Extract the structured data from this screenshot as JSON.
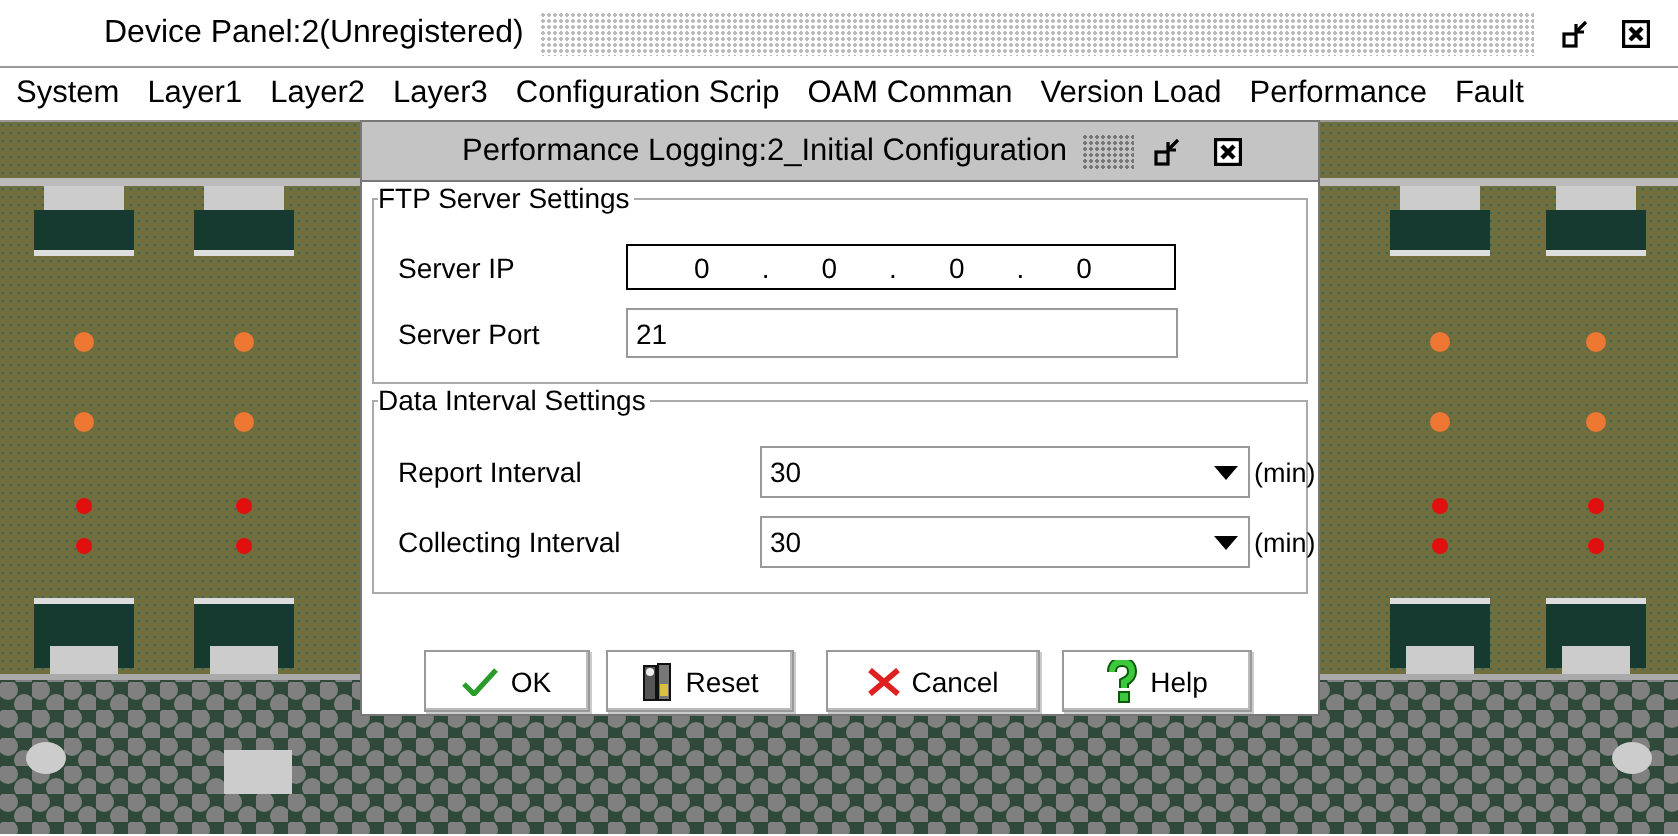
{
  "window": {
    "title": "Device Panel:2(Unregistered)"
  },
  "menu": [
    "System",
    "Layer1",
    "Layer2",
    "Layer3",
    "Configuration Scrip",
    "OAM Comman",
    "Version Load",
    "Performance",
    "Fault"
  ],
  "dialog": {
    "title": "Performance Logging:2_Initial Configuration",
    "groups": [
      {
        "title": "FTP Server Settings",
        "fields": [
          {
            "kind": "ip",
            "label": "Server IP",
            "octets": [
              "0",
              "0",
              "0",
              "0"
            ],
            "separators": [
              ".",
              ".",
              "."
            ]
          },
          {
            "kind": "text",
            "label": "Server Port",
            "value": "21"
          }
        ]
      },
      {
        "title": "Data Interval Settings",
        "fields": [
          {
            "kind": "combo",
            "label": "Report Interval",
            "value": "30",
            "unit": "(min)"
          },
          {
            "kind": "combo",
            "label": "Collecting Interval",
            "value": "30",
            "unit": "(min)"
          }
        ]
      }
    ],
    "buttons": [
      {
        "label": "OK",
        "kind": "check"
      },
      {
        "label": "Reset",
        "kind": "tools"
      },
      {
        "label": "Cancel",
        "kind": "cross"
      },
      {
        "label": "Help",
        "kind": "question"
      }
    ]
  }
}
